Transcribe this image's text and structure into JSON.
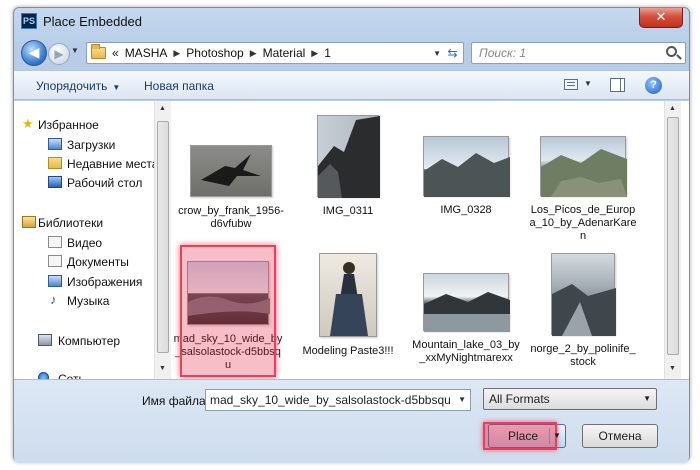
{
  "window": {
    "title": "Place Embedded",
    "app_icon": "PS",
    "close_glyph": "✕"
  },
  "address": {
    "prefix": "«",
    "crumbs": [
      "MASHA",
      "Photoshop",
      "Material",
      "1"
    ],
    "separator": "▶"
  },
  "search": {
    "placeholder": "Поиск: 1"
  },
  "toolbar": {
    "organize": "Упорядочить",
    "new_folder": "Новая папка",
    "help_glyph": "?"
  },
  "nav": {
    "favorites": "Избранное",
    "downloads": "Загрузки",
    "recent": "Недавние места",
    "desktop": "Рабочий стол",
    "libraries": "Библиотеки",
    "video": "Видео",
    "documents": "Документы",
    "images": "Изображения",
    "music": "Музыка",
    "computer": "Компьютер",
    "network": "Сеть"
  },
  "files": [
    {
      "name": "crow_by_frank_1956-d6vfubw"
    },
    {
      "name": "IMG_0311"
    },
    {
      "name": "IMG_0328"
    },
    {
      "name": "Los_Picos_de_Europa_10_by_AdenarKaren"
    },
    {
      "name": "mad_sky_10_wide_by_salsolastock-d5bbsqu"
    },
    {
      "name": "Modeling Paste3!!!"
    },
    {
      "name": "Mountain_lake_03_by_xxMyNightmarexx"
    },
    {
      "name": "norge_2_by_polinife_stock"
    }
  ],
  "footer": {
    "filename_label": "Имя файла:",
    "filename_value": "mad_sky_10_wide_by_salsolastock-d5bbsqu",
    "format_value": "All Formats",
    "place_button": "Place",
    "cancel_button": "Отмена"
  },
  "colors": {
    "selection_highlight": "#e8405a",
    "window_frame": "#bcd1ea"
  }
}
